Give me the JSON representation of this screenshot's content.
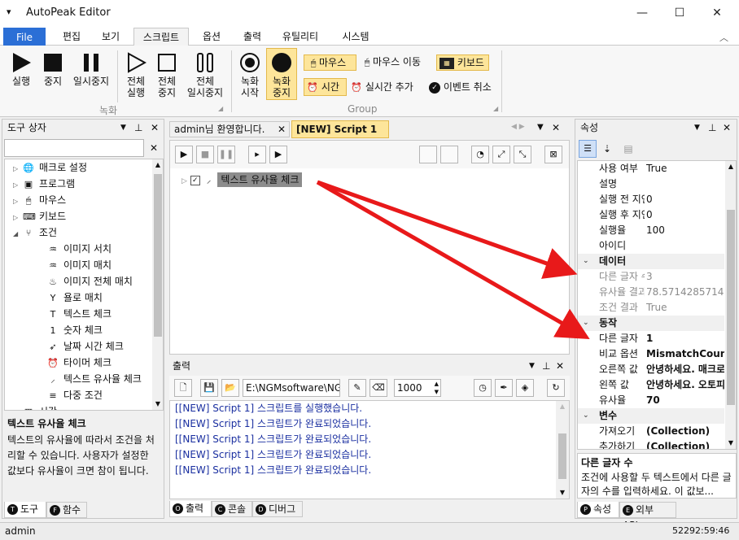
{
  "window": {
    "title": "AutoPeak Editor",
    "menu_icon": "menu-icon",
    "minimize": "—",
    "maximize": "☐",
    "close": "✕"
  },
  "tabs": [
    "File",
    "편집",
    "보기",
    "스크립트",
    "옵션",
    "출력",
    "유틸리티",
    "시스템"
  ],
  "ribbon": {
    "rec_group": "녹화",
    "group2": "Group",
    "run": "실행",
    "stop": "중지",
    "pause": "일시중지",
    "run_all_1": "전체",
    "run_all_2": "실행",
    "stop_all_1": "전체",
    "stop_all_2": "중지",
    "pause_all_1": "전체",
    "pause_all_2": "일시중지",
    "rec_start_1": "녹화",
    "rec_start_2": "시작",
    "rec_stop_1": "녹화",
    "rec_stop_2": "중지",
    "mouse": "마우스",
    "mouse_move": "마우스 이동",
    "keyboard": "키보드",
    "time": "시간",
    "realtime_add": "실시간 추가",
    "event_cancel": "이벤트 취소"
  },
  "toolbox": {
    "title": "도구 상자",
    "items": [
      {
        "label": "매크로 설정",
        "icon": "globe-icon"
      },
      {
        "label": "프로그램",
        "icon": "monitor-icon"
      },
      {
        "label": "마우스",
        "icon": "mouse-icon"
      },
      {
        "label": "키보드",
        "icon": "keyboard-icon"
      },
      {
        "label": "조건",
        "icon": "branch-icon"
      },
      {
        "label": "이미지 서치",
        "icon": "drops-icon"
      },
      {
        "label": "이미지 매치",
        "icon": "drops-icon"
      },
      {
        "label": "이미지 전체 매치",
        "icon": "drops-fill-icon"
      },
      {
        "label": "욜로 매치",
        "icon": "yolo-icon"
      },
      {
        "label": "텍스트 체크",
        "icon": "text-icon"
      },
      {
        "label": "숫자 체크",
        "icon": "number-icon"
      },
      {
        "label": "날짜 시간 체크",
        "icon": "rocket-icon"
      },
      {
        "label": "타이머 체크",
        "icon": "alarm-icon"
      },
      {
        "label": "텍스트 유사율 체크",
        "icon": "similar-icon"
      },
      {
        "label": "다중 조건",
        "icon": "multi-icon"
      },
      {
        "label": "시간",
        "icon": "calendar-icon"
      }
    ],
    "desc_title": "텍스트 유사율 체크",
    "desc_body": "텍스트의 유사율에 따라서 조건을 처리할 수 있습니다. 사용자가 설정한 값보다 유사율이 크면 참이 됩니다.",
    "tab_tools": "도구",
    "tab_functions": "함수"
  },
  "doc": {
    "tab1": "admin님 환영합니다.",
    "tab2": "[NEW] Script 1",
    "node_label": "텍스트 유사율 체크"
  },
  "output": {
    "title": "출력",
    "path": "E:\\NGMsoftware\\NG",
    "count": "1000",
    "lines": [
      "[[NEW] Script 1] 스크립트를 실행했습니다.",
      "[[NEW] Script 1] 스크립트가 완료되었습니다.",
      "[[NEW] Script 1] 스크립트가 완료되었습니다.",
      "[[NEW] Script 1] 스크립트가 완료되었습니다.",
      "[[NEW] Script 1] 스크립트가 완료되었습니다."
    ],
    "tab_output": "출력",
    "tab_console": "콘솔",
    "tab_debug": "디버그"
  },
  "properties": {
    "title": "속성",
    "rows_top": [
      {
        "name": "사용 여부",
        "value": "True"
      },
      {
        "name": "설명",
        "value": ""
      },
      {
        "name": "실행 전 지연",
        "value": "0"
      },
      {
        "name": "실행 후 지연",
        "value": "0"
      },
      {
        "name": "실행율",
        "value": "100"
      },
      {
        "name": "아이디",
        "value": ""
      }
    ],
    "cat_data": "데이터",
    "rows_data": [
      {
        "name": "다른 글자 수",
        "value": "3"
      },
      {
        "name": "유사율 결과",
        "value": "78.5714285714"
      },
      {
        "name": "조건 결과",
        "value": "True"
      }
    ],
    "cat_action": "동작",
    "rows_action": [
      {
        "name": "다른 글자",
        "value": "1"
      },
      {
        "name": "비교 옵션",
        "value": "MismatchCount"
      },
      {
        "name": "오른쪽 값",
        "value": "안녕하세요. 매크로"
      },
      {
        "name": "왼쪽 값",
        "value": "안녕하세요. 오토피"
      },
      {
        "name": "유사율",
        "value": "70"
      }
    ],
    "cat_vars": "변수",
    "rows_vars": [
      {
        "name": "가져오기",
        "value": "(Collection)"
      },
      {
        "name": "추가하기",
        "value": "(Collection)"
      }
    ],
    "help_title": "다른 글자 수",
    "help_body": "조건에 사용할 두 텍스트에서 다른 글자의 수를 입력하세요. 이 값보...",
    "tab_props": "속성",
    "tab_api": "외부 API"
  },
  "status": {
    "user": "admin",
    "time": "52292:59:46"
  },
  "colors": {
    "accent": "#2b6fd6",
    "highlight": "#fde59a",
    "arrow": "#e8191a",
    "output_text": "#1a2fa0"
  }
}
